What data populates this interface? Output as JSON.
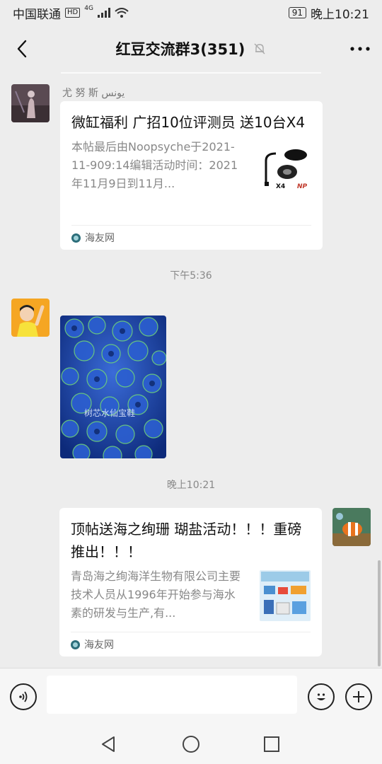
{
  "status_bar": {
    "carrier": "中国联通",
    "hd": "HD",
    "network": "4G",
    "battery": "91",
    "time": "晚上10:21"
  },
  "nav": {
    "title": "红豆交流群3(351)"
  },
  "messages": [
    {
      "sender": "尤 努 斯  يونس",
      "title": "微缸福利  广招10位评测员  送10台X4",
      "desc": "本帖最后由Noopsyche于2021-11-909:14编辑活动时间：2021年11月9日到11月...",
      "source": "海友网"
    },
    {
      "timestamp": "下午5:36",
      "image_caption": "树芯水仙宝鞋"
    },
    {
      "timestamp": "晚上10:21",
      "title": "顶帖送海之绚珊 瑚盐活动！！！重磅推出！！！",
      "desc": "青岛海之绚海洋生物有限公司主要技术人员从1996年开始参与海水素的研发与生产,有...",
      "source": "海友网"
    }
  ],
  "thumb_texts": {
    "ad_product": "X4",
    "ad_brand": "NP"
  },
  "colors": {
    "background": "#ededed",
    "card": "#ffffff",
    "muted_text": "#888888"
  }
}
